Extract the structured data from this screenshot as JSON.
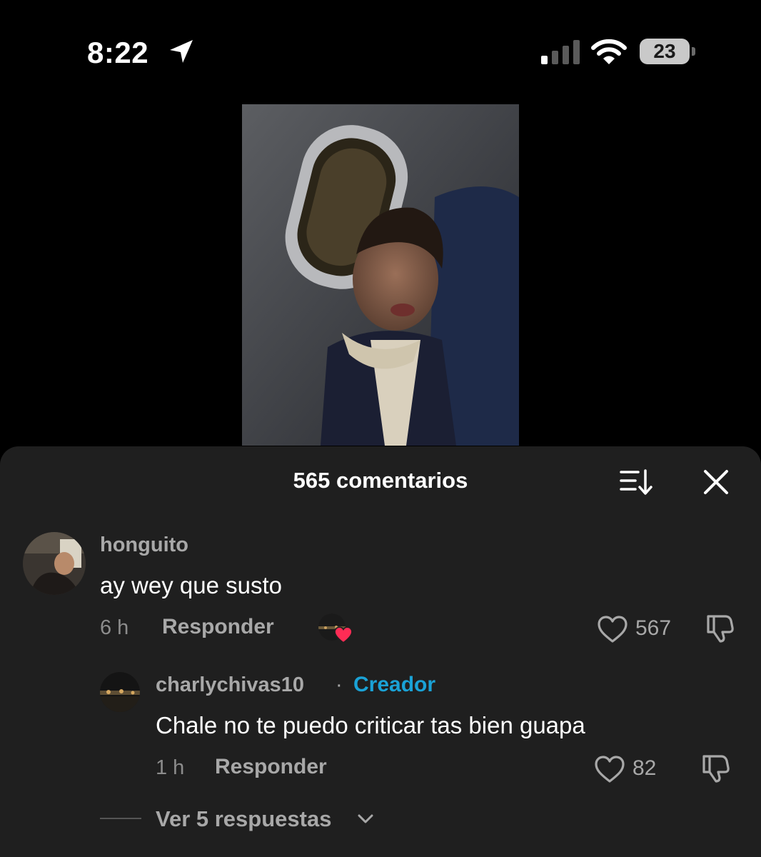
{
  "status_bar": {
    "time": "8:22",
    "battery_level": "23"
  },
  "comments_sheet": {
    "title": "565 comentarios",
    "comments": [
      {
        "username": "honguito",
        "text": "ay wey que susto",
        "age": "6 h",
        "reply_label": "Responder",
        "likes": "567"
      }
    ],
    "replies": [
      {
        "username": "charlychivas10",
        "separator": "·",
        "badge": "Creador",
        "text": "Chale no te puedo criticar tas bien guapa",
        "age": "1 h",
        "reply_label": "Responder",
        "likes": "82"
      }
    ],
    "view_more_replies": "Ver 5 respuestas"
  },
  "colors": {
    "sheet_background": "#1f1f1f",
    "creator_badge": "#1aa2d6",
    "creator_liked_heart": "#fe2c55"
  }
}
